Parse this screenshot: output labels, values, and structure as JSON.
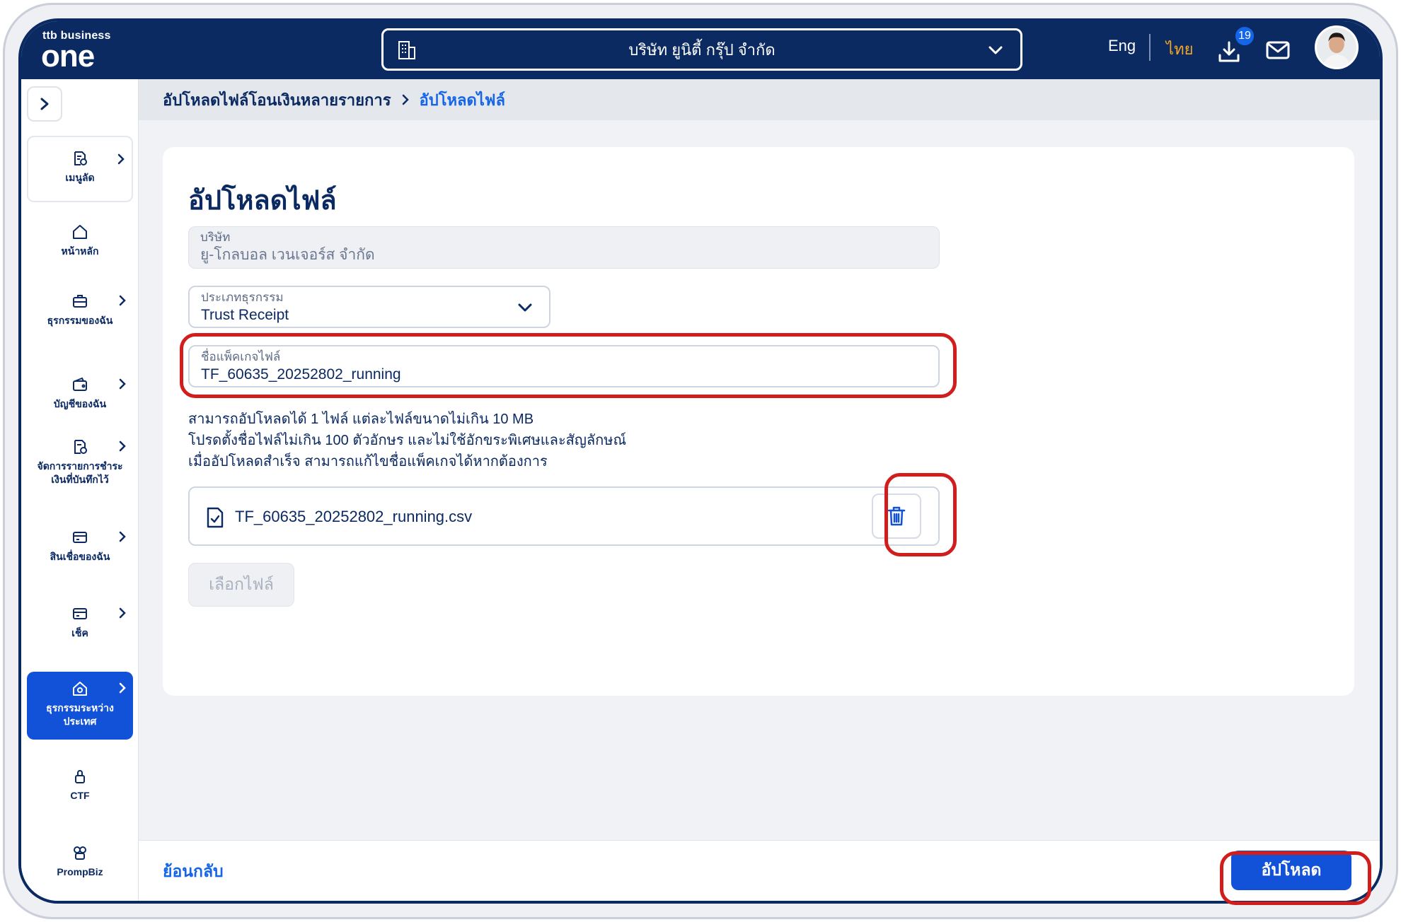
{
  "header": {
    "logo_small": "ttb business",
    "logo_big": "one",
    "company": "บริษัท ยูนิตี้ กรุ๊ป จำกัด",
    "lang_eng": "Eng",
    "lang_thai": "ไทย",
    "download_badge": "19"
  },
  "sidebar": {
    "items": [
      {
        "label": "เมนูลัด",
        "icon": "quick-menu-icon"
      },
      {
        "label": "หน้าหลัก",
        "icon": "home-icon"
      },
      {
        "label": "ธุรกรรมของฉัน",
        "icon": "briefcase-icon"
      },
      {
        "label": "บัญชีของฉัน",
        "icon": "wallet-icon"
      },
      {
        "label": "จัดการรายการชำระเงินที่บันทึกไว้",
        "icon": "payment-doc-icon"
      },
      {
        "label": "สินเชื่อของฉัน",
        "icon": "loan-card-icon"
      },
      {
        "label": "เช็ค",
        "icon": "cheque-icon"
      },
      {
        "label": "ธุรกรรมระหว่างประเทศ",
        "icon": "international-icon"
      },
      {
        "label": "CTF",
        "icon": "lock-icon"
      },
      {
        "label": "PrompBiz",
        "icon": "prompbiz-icon"
      }
    ]
  },
  "breadcrumb": {
    "parent": "อัปโหลดไฟล์โอนเงินหลายรายการ",
    "current": "อัปโหลดไฟล์"
  },
  "form": {
    "title": "อัปโหลดไฟล์",
    "company_label": "บริษัท",
    "company_value": "ยู-โกลบอล เวนเจอร์ส จำกัด",
    "type_label": "ประเภทธุรกรรม",
    "type_value": "Trust Receipt",
    "package_label": "ชื่อแพ็คเกจไฟล์",
    "package_value": "TF_60635_20252802_running",
    "hint_lines": [
      "สามารถอัปโหลดได้ 1 ไฟล์ แต่ละไฟล์ขนาดไม่เกิน 10 MB",
      "โปรดตั้งชื่อไฟล์ไม่เกิน 100 ตัวอักษร และไม่ใช้อักขระพิเศษและสัญลักษณ์",
      "เมื่ออัปโหลดสำเร็จ สามารถแก้ไขชื่อแพ็คเกจได้หากต้องการ"
    ],
    "file_name": "TF_60635_20252802_running.csv",
    "choose_file_label": "เลือกไฟล์"
  },
  "footer": {
    "back_label": "ย้อนกลับ",
    "upload_label": "อัปโหลด"
  },
  "colors": {
    "navy": "#0b2a62",
    "accent_blue": "#1252d8",
    "highlight_red": "#d21d1d",
    "thai_orange": "#f5a623"
  }
}
